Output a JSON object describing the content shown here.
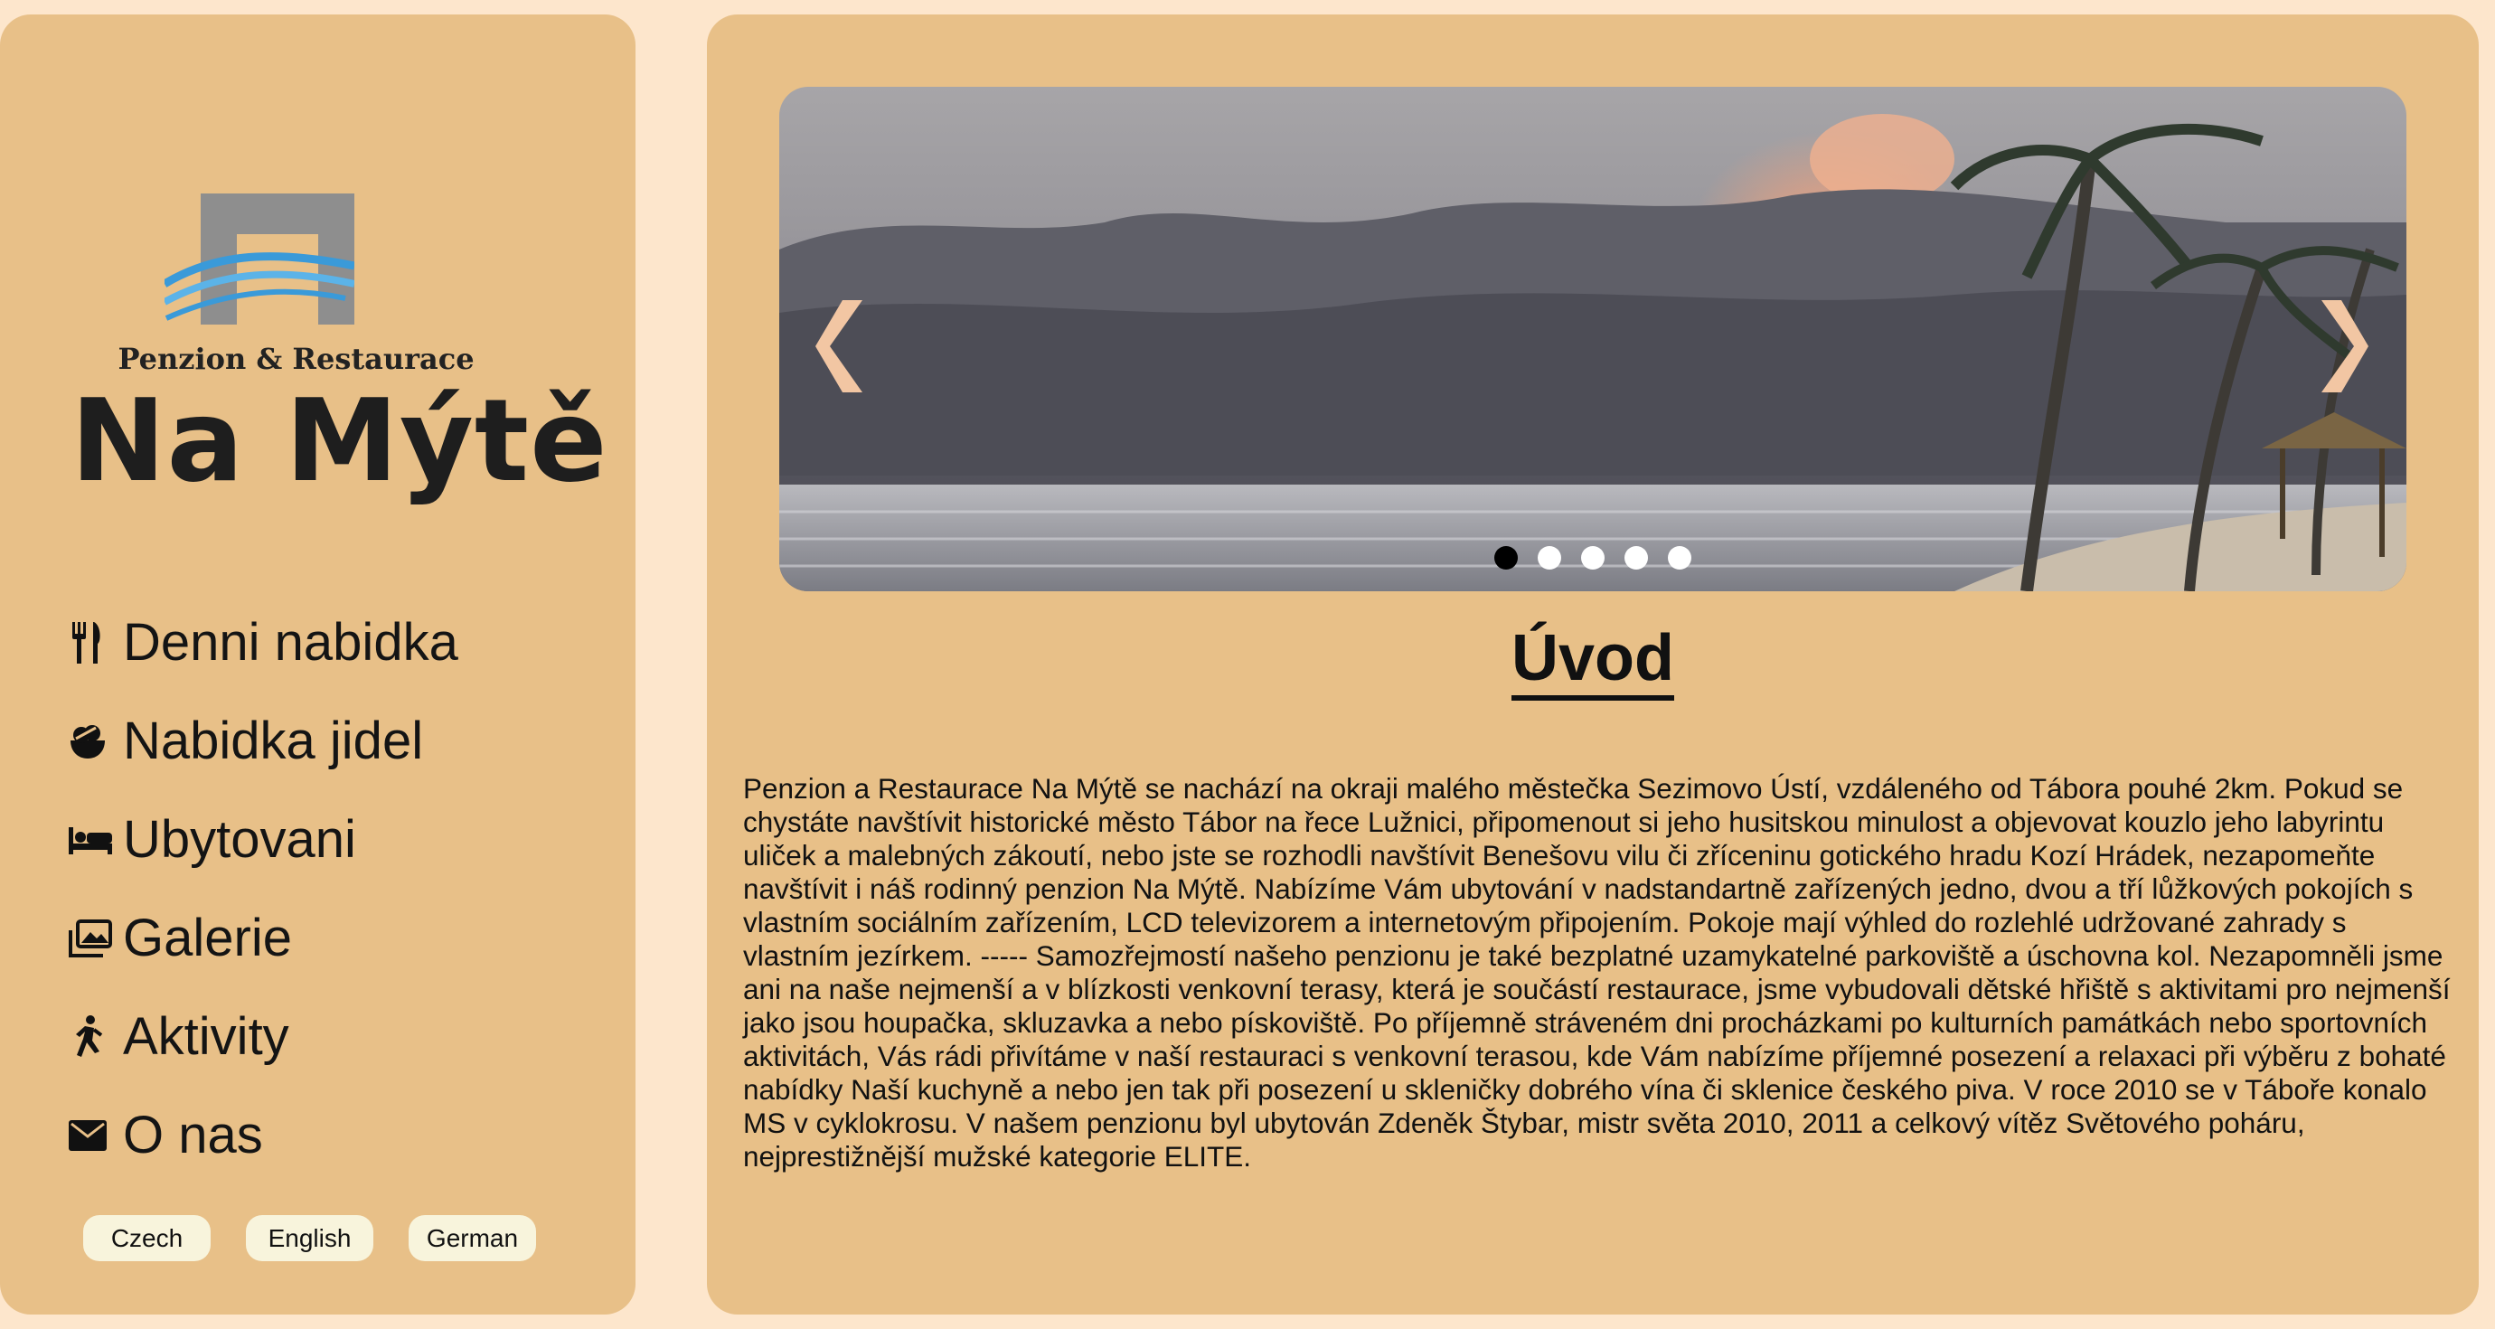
{
  "logo": {
    "subtitle": "Penzion & Restaurace",
    "name": "Na Mýtě"
  },
  "nav": {
    "items": [
      {
        "label": "Denni nabidka",
        "icon": "utensils-icon"
      },
      {
        "label": "Nabidka jidel",
        "icon": "bowl-icon"
      },
      {
        "label": "Ubytovani",
        "icon": "bed-icon"
      },
      {
        "label": "Galerie",
        "icon": "gallery-icon"
      },
      {
        "label": "Aktivity",
        "icon": "running-person-icon"
      },
      {
        "label": "O nas",
        "icon": "envelope-icon"
      }
    ]
  },
  "languages": {
    "czech": "Czech",
    "english": "English",
    "german": "German"
  },
  "slider": {
    "prev_glyph": "❮",
    "next_glyph": "❯",
    "slide_count": 5,
    "active_slide": 1
  },
  "main": {
    "title": "Úvod",
    "text": "Penzion a Restaurace Na Mýtě se nachází na okraji malého městečka Sezimovo Ústí, vzdáleného od Tábora pouhé 2km. Pokud se chystáte navštívit historické město Tábor na řece Lužnici, připomenout si jeho husitskou minulost a objevovat kouzlo jeho labyrintu uliček a malebných zákoutí, nebo jste se rozhodli navštívit Benešovu vilu či zříceninu gotického hradu Kozí Hrádek, nezapomeňte navštívit i náš rodinný penzion Na Mýtě. Nabízíme Vám ubytování v nadstandartně zařízených jedno, dvou a tří lůžkových pokojích s vlastním sociálním zařízením, LCD televizorem a internetovým připojením. Pokoje mají výhled do rozlehlé udržované zahrady s vlastním jezírkem. ----- Samozřejmostí našeho penzionu je také bezplatné uzamykatelné parkoviště a úschovna kol. Nezapomněli jsme ani na naše nejmenší a v blízkosti venkovní terasy, která je součástí restaurace, jsme vybudovali dětské hřiště s aktivitami pro nejmenší jako jsou houpačka, skluzavka a nebo pískoviště. Po příjemně stráveném dni procházkami po kulturních památkách nebo sportovních aktivitách, Vás rádi přivítáme v naší restauraci s venkovní terasou, kde Vám nabízíme příjemné posezení a relaxaci při výběru z bohaté nabídky Naší kuchyně a nebo jen tak při posezení u skleničky dobrého vína či sklenice českého piva. V roce 2010 se v Táboře konalo MS v cyklokrosu. V našem penzionu byl ubytován Zdeněk Štybar, mistr světa 2010, 2011 a celkový vítěz Světového poháru, nejprestižnější mužské kategorie ELITE."
  },
  "colors": {
    "page_bg": "#fde6cc",
    "panel_bg": "#e8c088",
    "lang_button_bg": "#f8f4dc",
    "logo_gray": "#8e8e8e",
    "logo_blue": "#3a9ad9"
  }
}
